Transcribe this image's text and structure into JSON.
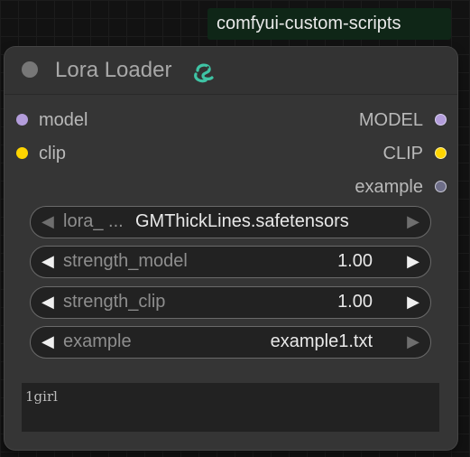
{
  "badge": {
    "text": "comfyui-custom-scripts"
  },
  "node": {
    "title": "Lora Loader",
    "title_icon": "snake-icon",
    "inputs": [
      {
        "label": "model",
        "color": "#b39ddb"
      },
      {
        "label": "clip",
        "color": "#ffd500"
      }
    ],
    "outputs": [
      {
        "label": "MODEL",
        "color": "#b39ddb"
      },
      {
        "label": "CLIP",
        "color": "#ffd500"
      },
      {
        "label": "example",
        "color": "#6e6e88"
      }
    ],
    "widgets": {
      "lora_name": {
        "label": "lora_ ...",
        "value": "GMThickLines.safetensors"
      },
      "strength_model": {
        "label": "strength_model",
        "value": "1.00"
      },
      "strength_clip": {
        "label": "strength_clip",
        "value": "1.00"
      },
      "example": {
        "label": "example",
        "value": "example1.txt"
      }
    },
    "text": "1girl"
  }
}
